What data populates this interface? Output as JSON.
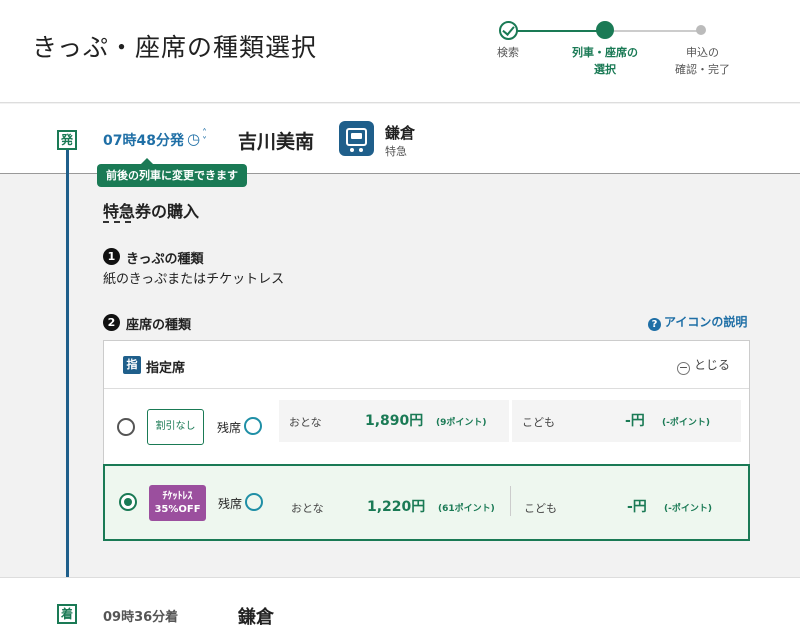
{
  "page_title": "きっぷ・座席の種類選択",
  "stepper": {
    "steps": [
      {
        "label": "検索",
        "state": "done"
      },
      {
        "label": "列車・座席の\n選択",
        "state": "current"
      },
      {
        "label": "申込の\n確認・完了",
        "state": "todo"
      }
    ]
  },
  "departure": {
    "marker": "発",
    "time": "07時48分発",
    "station": "吉川美南",
    "destination": "鎌倉",
    "train_type": "特急",
    "tooltip": "前後の列車に変更できます"
  },
  "purchase": {
    "title": "特急券の購入",
    "q1": {
      "num": "1",
      "title": "きっぷの種類",
      "value": "紙のきっぷまたはチケットレス"
    },
    "q2": {
      "num": "2",
      "title": "座席の種類"
    },
    "help_link": "アイコンの説明"
  },
  "seat_panel": {
    "badge": "指",
    "class_name": "指定席",
    "collapse_label": "とじる",
    "rows": [
      {
        "selected": false,
        "discount": "割引なし",
        "availability_label": "残席",
        "adult_label": "おとな",
        "adult_price": "1,890円",
        "adult_points": "(9ポイント)",
        "child_label": "こども",
        "child_price": "-円",
        "child_points": "(-ポイント)"
      },
      {
        "selected": true,
        "discount_line1": "ﾁｹｯﾄﾚｽ",
        "discount_line2": "35%OFF",
        "availability_label": "残席",
        "adult_label": "おとな",
        "adult_price": "1,220円",
        "adult_points": "(61ポイント)",
        "child_label": "こども",
        "child_price": "-円",
        "child_points": "(-ポイント)"
      }
    ]
  },
  "arrival": {
    "marker": "着",
    "time": "09時36分着",
    "station": "鎌倉"
  },
  "colors": {
    "accent_green": "#1a7a55",
    "accent_blue": "#1f6fa6",
    "promo_purple": "#9b4f9e"
  }
}
